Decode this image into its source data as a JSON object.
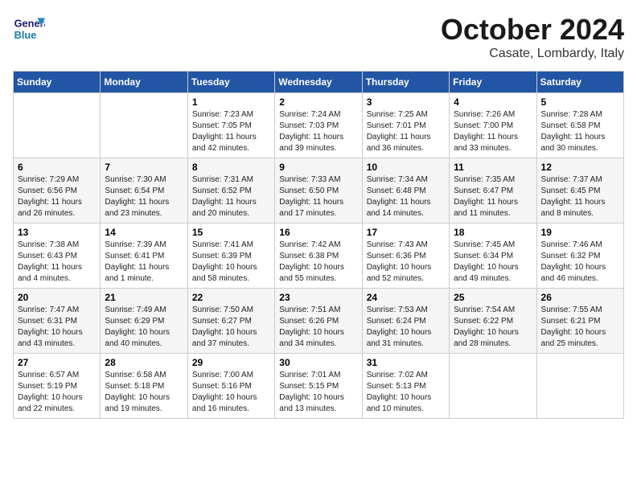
{
  "logo": {
    "line1": "General",
    "line2": "Blue"
  },
  "title": "October 2024",
  "location": "Casate, Lombardy, Italy",
  "weekdays": [
    "Sunday",
    "Monday",
    "Tuesday",
    "Wednesday",
    "Thursday",
    "Friday",
    "Saturday"
  ],
  "weeks": [
    [
      {
        "day": "",
        "info": ""
      },
      {
        "day": "",
        "info": ""
      },
      {
        "day": "1",
        "info": "Sunrise: 7:23 AM\nSunset: 7:05 PM\nDaylight: 11 hours\nand 42 minutes."
      },
      {
        "day": "2",
        "info": "Sunrise: 7:24 AM\nSunset: 7:03 PM\nDaylight: 11 hours\nand 39 minutes."
      },
      {
        "day": "3",
        "info": "Sunrise: 7:25 AM\nSunset: 7:01 PM\nDaylight: 11 hours\nand 36 minutes."
      },
      {
        "day": "4",
        "info": "Sunrise: 7:26 AM\nSunset: 7:00 PM\nDaylight: 11 hours\nand 33 minutes."
      },
      {
        "day": "5",
        "info": "Sunrise: 7:28 AM\nSunset: 6:58 PM\nDaylight: 11 hours\nand 30 minutes."
      }
    ],
    [
      {
        "day": "6",
        "info": "Sunrise: 7:29 AM\nSunset: 6:56 PM\nDaylight: 11 hours\nand 26 minutes."
      },
      {
        "day": "7",
        "info": "Sunrise: 7:30 AM\nSunset: 6:54 PM\nDaylight: 11 hours\nand 23 minutes."
      },
      {
        "day": "8",
        "info": "Sunrise: 7:31 AM\nSunset: 6:52 PM\nDaylight: 11 hours\nand 20 minutes."
      },
      {
        "day": "9",
        "info": "Sunrise: 7:33 AM\nSunset: 6:50 PM\nDaylight: 11 hours\nand 17 minutes."
      },
      {
        "day": "10",
        "info": "Sunrise: 7:34 AM\nSunset: 6:48 PM\nDaylight: 11 hours\nand 14 minutes."
      },
      {
        "day": "11",
        "info": "Sunrise: 7:35 AM\nSunset: 6:47 PM\nDaylight: 11 hours\nand 11 minutes."
      },
      {
        "day": "12",
        "info": "Sunrise: 7:37 AM\nSunset: 6:45 PM\nDaylight: 11 hours\nand 8 minutes."
      }
    ],
    [
      {
        "day": "13",
        "info": "Sunrise: 7:38 AM\nSunset: 6:43 PM\nDaylight: 11 hours\nand 4 minutes."
      },
      {
        "day": "14",
        "info": "Sunrise: 7:39 AM\nSunset: 6:41 PM\nDaylight: 11 hours\nand 1 minute."
      },
      {
        "day": "15",
        "info": "Sunrise: 7:41 AM\nSunset: 6:39 PM\nDaylight: 10 hours\nand 58 minutes."
      },
      {
        "day": "16",
        "info": "Sunrise: 7:42 AM\nSunset: 6:38 PM\nDaylight: 10 hours\nand 55 minutes."
      },
      {
        "day": "17",
        "info": "Sunrise: 7:43 AM\nSunset: 6:36 PM\nDaylight: 10 hours\nand 52 minutes."
      },
      {
        "day": "18",
        "info": "Sunrise: 7:45 AM\nSunset: 6:34 PM\nDaylight: 10 hours\nand 49 minutes."
      },
      {
        "day": "19",
        "info": "Sunrise: 7:46 AM\nSunset: 6:32 PM\nDaylight: 10 hours\nand 46 minutes."
      }
    ],
    [
      {
        "day": "20",
        "info": "Sunrise: 7:47 AM\nSunset: 6:31 PM\nDaylight: 10 hours\nand 43 minutes."
      },
      {
        "day": "21",
        "info": "Sunrise: 7:49 AM\nSunset: 6:29 PM\nDaylight: 10 hours\nand 40 minutes."
      },
      {
        "day": "22",
        "info": "Sunrise: 7:50 AM\nSunset: 6:27 PM\nDaylight: 10 hours\nand 37 minutes."
      },
      {
        "day": "23",
        "info": "Sunrise: 7:51 AM\nSunset: 6:26 PM\nDaylight: 10 hours\nand 34 minutes."
      },
      {
        "day": "24",
        "info": "Sunrise: 7:53 AM\nSunset: 6:24 PM\nDaylight: 10 hours\nand 31 minutes."
      },
      {
        "day": "25",
        "info": "Sunrise: 7:54 AM\nSunset: 6:22 PM\nDaylight: 10 hours\nand 28 minutes."
      },
      {
        "day": "26",
        "info": "Sunrise: 7:55 AM\nSunset: 6:21 PM\nDaylight: 10 hours\nand 25 minutes."
      }
    ],
    [
      {
        "day": "27",
        "info": "Sunrise: 6:57 AM\nSunset: 5:19 PM\nDaylight: 10 hours\nand 22 minutes."
      },
      {
        "day": "28",
        "info": "Sunrise: 6:58 AM\nSunset: 5:18 PM\nDaylight: 10 hours\nand 19 minutes."
      },
      {
        "day": "29",
        "info": "Sunrise: 7:00 AM\nSunset: 5:16 PM\nDaylight: 10 hours\nand 16 minutes."
      },
      {
        "day": "30",
        "info": "Sunrise: 7:01 AM\nSunset: 5:15 PM\nDaylight: 10 hours\nand 13 minutes."
      },
      {
        "day": "31",
        "info": "Sunrise: 7:02 AM\nSunset: 5:13 PM\nDaylight: 10 hours\nand 10 minutes."
      },
      {
        "day": "",
        "info": ""
      },
      {
        "day": "",
        "info": ""
      }
    ]
  ]
}
